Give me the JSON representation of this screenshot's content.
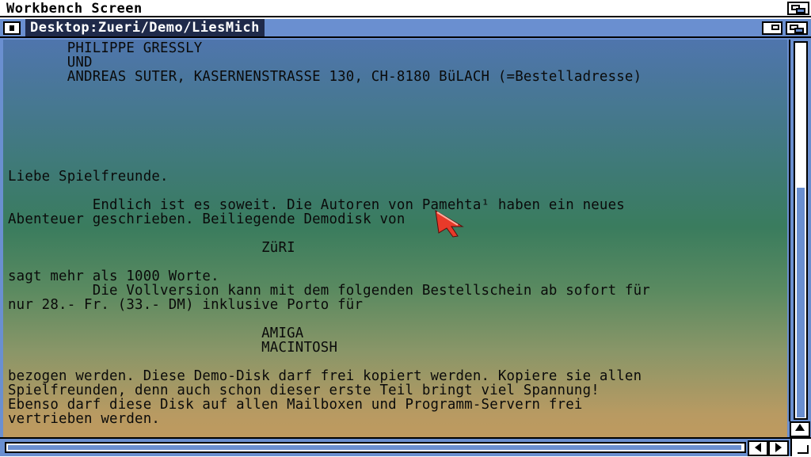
{
  "screen": {
    "title": "Workbench Screen"
  },
  "window": {
    "title": "Desktop:Zueri/Demo/LiesMich"
  },
  "document": {
    "lines": [
      "       PHILIPPE GRESSLY",
      "       UND",
      "       ANDREAS SUTER, KASERNENSTRASSE 130, CH-8180 BüLACH (=Bestelladresse)",
      "",
      "",
      "",
      "",
      "",
      "",
      "Liebe Spielfreunde.",
      "",
      "          Endlich ist es soweit. Die Autoren von Pamehta¹ haben ein neues",
      "Abenteuer geschrieben. Beiliegende Demodisk von",
      "",
      "                              ZüRI",
      "",
      "sagt mehr als 1000 Worte.",
      "          Die Vollversion kann mit dem folgenden Bestellschein ab sofort für",
      "nur 28.- Fr. (33.- DM) inklusive Porto für",
      "",
      "                              AMIGA",
      "                              MACINTOSH",
      "",
      "bezogen werden. Diese Demo-Disk darf frei kopiert werden. Kopiere sie allen",
      "Spielfreunden, denn auch schon dieser erste Teil bringt viel Spannung!",
      "Ebenso darf diese Disk auf allen Mailboxen und Programm-Servern frei",
      "vertrieben werden."
    ]
  },
  "scrollbars": {
    "vertical_position": 0.38,
    "up_arrow_icon": "up-arrow-icon",
    "down_arrow_icon": "down-arrow-icon",
    "left_arrow_icon": "left-arrow-icon",
    "right_arrow_icon": "right-arrow-icon"
  },
  "colors": {
    "window_frame": "#6a8fd0",
    "title_bg": "#1f2a4a",
    "gradient_top": "#4f75ad",
    "gradient_bottom": "#c49a5c",
    "pointer": "#e83a2a"
  }
}
